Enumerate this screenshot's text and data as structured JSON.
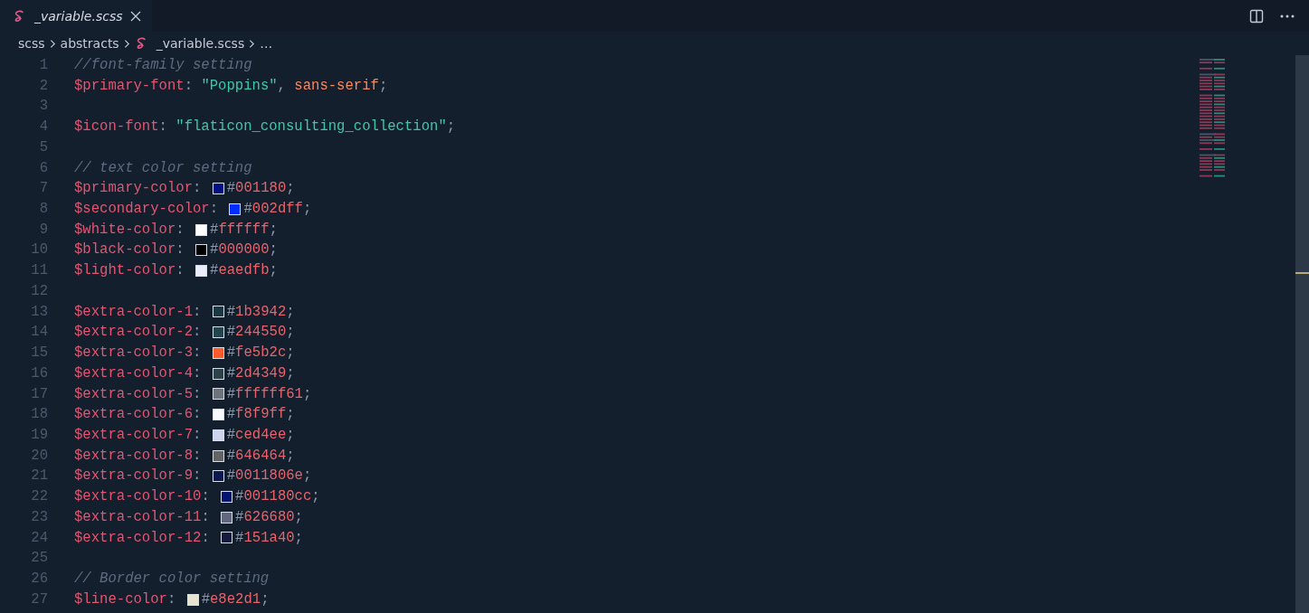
{
  "tab": {
    "title": "_variable.scss",
    "preview": true
  },
  "breadcrumb": [
    {
      "label": "scss",
      "kind": "folder"
    },
    {
      "label": "abstracts",
      "kind": "folder"
    },
    {
      "label": "_variable.scss",
      "kind": "file"
    },
    {
      "label": "…",
      "kind": "more"
    }
  ],
  "lines": [
    {
      "number": "1",
      "segments": [
        {
          "kind": "comment",
          "text": "//font-family setting"
        }
      ]
    },
    {
      "number": "2",
      "segments": [
        {
          "kind": "variable",
          "text": "$primary-font"
        },
        {
          "kind": "punct",
          "text": ": "
        },
        {
          "kind": "string",
          "text": "\"Poppins\""
        },
        {
          "kind": "punct",
          "text": ", "
        },
        {
          "kind": "keyword",
          "text": "sans-serif"
        },
        {
          "kind": "punct",
          "text": ";"
        }
      ]
    },
    {
      "number": "3"
    },
    {
      "number": "4",
      "segments": [
        {
          "kind": "variable",
          "text": "$icon-font"
        },
        {
          "kind": "punct",
          "text": ": "
        },
        {
          "kind": "string",
          "text": "\"flaticon_consulting_collection\""
        },
        {
          "kind": "punct",
          "text": ";"
        }
      ]
    },
    {
      "number": "5"
    },
    {
      "number": "6",
      "segments": [
        {
          "kind": "comment",
          "text": "// text color setting"
        }
      ]
    },
    {
      "number": "7",
      "segments": [
        {
          "kind": "variable",
          "text": "$primary-color"
        },
        {
          "kind": "punct",
          "text": ": "
        },
        {
          "kind": "swatch",
          "color": "#001180"
        },
        {
          "kind": "punct",
          "text": "#"
        },
        {
          "kind": "hex",
          "text": "001180"
        },
        {
          "kind": "punct",
          "text": ";"
        }
      ]
    },
    {
      "number": "8",
      "segments": [
        {
          "kind": "variable",
          "text": "$secondary-color"
        },
        {
          "kind": "punct",
          "text": ": "
        },
        {
          "kind": "swatch",
          "color": "#002dff"
        },
        {
          "kind": "punct",
          "text": "#"
        },
        {
          "kind": "hex",
          "text": "002dff"
        },
        {
          "kind": "punct",
          "text": ";"
        }
      ]
    },
    {
      "number": "9",
      "segments": [
        {
          "kind": "variable",
          "text": "$white-color"
        },
        {
          "kind": "punct",
          "text": ": "
        },
        {
          "kind": "swatch",
          "color": "#ffffff"
        },
        {
          "kind": "punct",
          "text": "#"
        },
        {
          "kind": "hex",
          "text": "ffffff"
        },
        {
          "kind": "punct",
          "text": ";"
        }
      ]
    },
    {
      "number": "10",
      "segments": [
        {
          "kind": "variable",
          "text": "$black-color"
        },
        {
          "kind": "punct",
          "text": ": "
        },
        {
          "kind": "swatch",
          "color": "#000000"
        },
        {
          "kind": "punct",
          "text": "#"
        },
        {
          "kind": "hex",
          "text": "000000"
        },
        {
          "kind": "punct",
          "text": ";"
        }
      ]
    },
    {
      "number": "11",
      "segments": [
        {
          "kind": "variable",
          "text": "$light-color"
        },
        {
          "kind": "punct",
          "text": ": "
        },
        {
          "kind": "swatch",
          "color": "#eaedfb"
        },
        {
          "kind": "punct",
          "text": "#"
        },
        {
          "kind": "hex",
          "text": "eaedfb"
        },
        {
          "kind": "punct",
          "text": ";"
        }
      ]
    },
    {
      "number": "12"
    },
    {
      "number": "13",
      "segments": [
        {
          "kind": "variable",
          "text": "$extra-color-1"
        },
        {
          "kind": "punct",
          "text": ": "
        },
        {
          "kind": "swatch",
          "color": "#1b3942"
        },
        {
          "kind": "punct",
          "text": "#"
        },
        {
          "kind": "hex",
          "text": "1b3942"
        },
        {
          "kind": "punct",
          "text": ";"
        }
      ]
    },
    {
      "number": "14",
      "segments": [
        {
          "kind": "variable",
          "text": "$extra-color-2"
        },
        {
          "kind": "punct",
          "text": ": "
        },
        {
          "kind": "swatch",
          "color": "#244550"
        },
        {
          "kind": "punct",
          "text": "#"
        },
        {
          "kind": "hex",
          "text": "244550"
        },
        {
          "kind": "punct",
          "text": ";"
        }
      ]
    },
    {
      "number": "15",
      "segments": [
        {
          "kind": "variable",
          "text": "$extra-color-3"
        },
        {
          "kind": "punct",
          "text": ": "
        },
        {
          "kind": "swatch",
          "color": "#fe5b2c"
        },
        {
          "kind": "punct",
          "text": "#"
        },
        {
          "kind": "hex",
          "text": "fe5b2c"
        },
        {
          "kind": "punct",
          "text": ";"
        }
      ]
    },
    {
      "number": "16",
      "segments": [
        {
          "kind": "variable",
          "text": "$extra-color-4"
        },
        {
          "kind": "punct",
          "text": ": "
        },
        {
          "kind": "swatch",
          "color": "#2d4349"
        },
        {
          "kind": "punct",
          "text": "#"
        },
        {
          "kind": "hex",
          "text": "2d4349"
        },
        {
          "kind": "punct",
          "text": ";"
        }
      ]
    },
    {
      "number": "17",
      "segments": [
        {
          "kind": "variable",
          "text": "$extra-color-5"
        },
        {
          "kind": "punct",
          "text": ": "
        },
        {
          "kind": "swatch",
          "color": "#6e747c"
        },
        {
          "kind": "punct",
          "text": "#"
        },
        {
          "kind": "hex",
          "text": "ffffff61"
        },
        {
          "kind": "punct",
          "text": ";"
        }
      ]
    },
    {
      "number": "18",
      "segments": [
        {
          "kind": "variable",
          "text": "$extra-color-6"
        },
        {
          "kind": "punct",
          "text": ": "
        },
        {
          "kind": "swatch",
          "color": "#f8f9ff"
        },
        {
          "kind": "punct",
          "text": "#"
        },
        {
          "kind": "hex",
          "text": "f8f9ff"
        },
        {
          "kind": "punct",
          "text": ";"
        }
      ]
    },
    {
      "number": "19",
      "segments": [
        {
          "kind": "variable",
          "text": "$extra-color-7"
        },
        {
          "kind": "punct",
          "text": ": "
        },
        {
          "kind": "swatch",
          "color": "#ced4ee"
        },
        {
          "kind": "punct",
          "text": "#"
        },
        {
          "kind": "hex",
          "text": "ced4ee"
        },
        {
          "kind": "punct",
          "text": ";"
        }
      ]
    },
    {
      "number": "20",
      "segments": [
        {
          "kind": "variable",
          "text": "$extra-color-8"
        },
        {
          "kind": "punct",
          "text": ": "
        },
        {
          "kind": "swatch",
          "color": "#646464"
        },
        {
          "kind": "punct",
          "text": "#"
        },
        {
          "kind": "hex",
          "text": "646464"
        },
        {
          "kind": "punct",
          "text": ";"
        }
      ]
    },
    {
      "number": "21",
      "segments": [
        {
          "kind": "variable",
          "text": "$extra-color-9"
        },
        {
          "kind": "punct",
          "text": ": "
        },
        {
          "kind": "swatch",
          "color": "#0c1951"
        },
        {
          "kind": "punct",
          "text": "#"
        },
        {
          "kind": "hex",
          "text": "0011806e"
        },
        {
          "kind": "punct",
          "text": ";"
        }
      ]
    },
    {
      "number": "22",
      "segments": [
        {
          "kind": "variable",
          "text": "$extra-color-10"
        },
        {
          "kind": "punct",
          "text": ": "
        },
        {
          "kind": "swatch",
          "color": "#041470"
        },
        {
          "kind": "punct",
          "text": "#"
        },
        {
          "kind": "hex",
          "text": "001180cc"
        },
        {
          "kind": "punct",
          "text": ";"
        }
      ]
    },
    {
      "number": "23",
      "segments": [
        {
          "kind": "variable",
          "text": "$extra-color-11"
        },
        {
          "kind": "punct",
          "text": ": "
        },
        {
          "kind": "swatch",
          "color": "#626680"
        },
        {
          "kind": "punct",
          "text": "#"
        },
        {
          "kind": "hex",
          "text": "626680"
        },
        {
          "kind": "punct",
          "text": ";"
        }
      ]
    },
    {
      "number": "24",
      "segments": [
        {
          "kind": "variable",
          "text": "$extra-color-12"
        },
        {
          "kind": "punct",
          "text": ": "
        },
        {
          "kind": "swatch",
          "color": "#151a40"
        },
        {
          "kind": "punct",
          "text": "#"
        },
        {
          "kind": "hex",
          "text": "151a40"
        },
        {
          "kind": "punct",
          "text": ";"
        }
      ]
    },
    {
      "number": "25"
    },
    {
      "number": "26",
      "segments": [
        {
          "kind": "comment",
          "text": "// Border color setting"
        }
      ]
    },
    {
      "number": "27",
      "segments": [
        {
          "kind": "variable",
          "text": "$line-color"
        },
        {
          "kind": "punct",
          "text": ": "
        },
        {
          "kind": "swatch",
          "color": "#e8e2d1"
        },
        {
          "kind": "punct",
          "text": "#"
        },
        {
          "kind": "hex",
          "text": "e8e2d1"
        },
        {
          "kind": "punct",
          "text": ";"
        }
      ]
    }
  ]
}
